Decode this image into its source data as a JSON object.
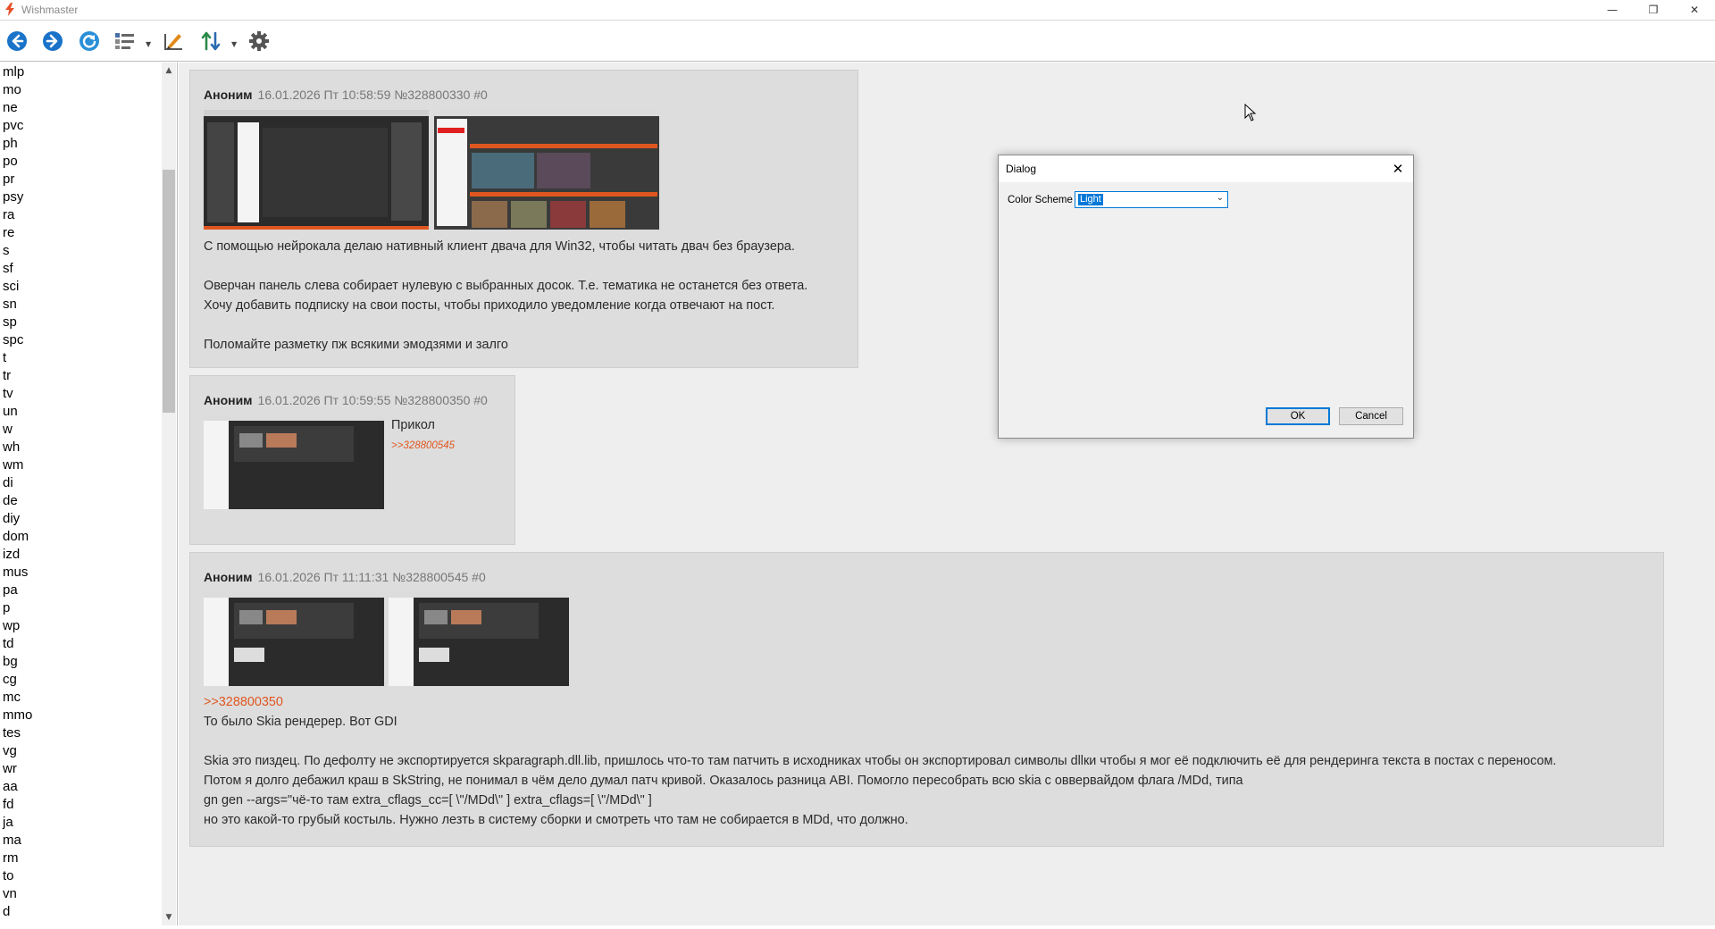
{
  "window": {
    "title": "Wishmaster",
    "minimize_glyph": "—",
    "restore_glyph": "❐",
    "close_glyph": "✕"
  },
  "toolbar": {
    "buttons": [
      {
        "icon": "back-arrow-icon",
        "color": "#1a73c8"
      },
      {
        "icon": "forward-arrow-icon",
        "color": "#1a73c8"
      },
      {
        "icon": "refresh-icon",
        "color": "#2a8fd8"
      },
      {
        "icon": "list-view-icon",
        "color": "#555555"
      },
      {
        "icon": "edit-ruler-icon",
        "color": "#e08a1a"
      },
      {
        "icon": "sort-icon",
        "color": "#2a8a4a"
      },
      {
        "icon": "settings-gear-icon",
        "color": "#555555"
      }
    ]
  },
  "sidebar": {
    "boards": [
      "mlp",
      "mo",
      "ne",
      "pvc",
      "ph",
      "po",
      "pr",
      "psy",
      "ra",
      "re",
      "s",
      "sf",
      "sci",
      "sn",
      "sp",
      "spc",
      "t",
      "tr",
      "tv",
      "un",
      "w",
      "wh",
      "wm",
      "di",
      "de",
      "diy",
      "dom",
      "izd",
      "mus",
      "pa",
      "p",
      "wp",
      "td",
      "bg",
      "cg",
      "mc",
      "mmo",
      "tes",
      "vg",
      "wr",
      "aa",
      "fd",
      "ja",
      "ma",
      "rm",
      "to",
      "vn",
      "d"
    ]
  },
  "posts": [
    {
      "author": "Аноним",
      "meta": "16.01.2026 Пт 10:58:59 №328800330 #0",
      "lines": [
        "С помощью нейрокала делаю нативный клиент двача для Win32, чтобы читать двач без браузера.",
        "",
        "Оверчан панель слева собирает нулевую с выбранных досок. Т.е. тематика не останется без ответа.",
        "Хочу добавить подписку на свои посты, чтобы приходило уведомление когда отвечают на пост.",
        "",
        "Поломайте разметку пж всякими эмодзями и залго"
      ]
    },
    {
      "author": "Аноним",
      "meta": "16.01.2026 Пт 10:59:55 №328800350 #0",
      "text": "Прикол",
      "reply_link": ">>328800545"
    },
    {
      "author": "Аноним",
      "meta": "16.01.2026 Пт 11:11:31 №328800545 #0",
      "reply_link": ">>328800350",
      "lines": [
        "То было Skia рендерер. Вот GDI",
        "",
        "Skia это пиздец. По дефолту не экспортируется skparagraph.dll.lib, пришлось что-то там патчить в исходниках чтобы он экспортировал символы dllки чтобы я мог её подключить её для рендеринга текста в постах с переносом.",
        "Потом я долго дебажил краш в SkString, не понимал в чём дело думал патч кривой. Оказалось разница ABI. Помогло пересобрать всю skia с оввервайдом флага /MDd, типа",
        "gn gen --args=\"чё-то там extra_cflags_cc=[ \\\"/MDd\\\" ] extra_cflags=[ \\\"/MDd\\\" ]",
        "но это какой-то грубый костыль. Нужно лезть в систему сборки и смотреть что там не собирается в MDd, что должно."
      ]
    }
  ],
  "dialog": {
    "title": "Dialog",
    "close_glyph": "✕",
    "color_scheme_label": "Color Scheme",
    "color_scheme_value": "Light",
    "ok_label": "OK",
    "cancel_label": "Cancel"
  },
  "colors": {
    "accent": "#0078d7",
    "reply_link": "#e0561f",
    "post_bg": "#dddddd",
    "content_bg": "#eeeeee"
  }
}
